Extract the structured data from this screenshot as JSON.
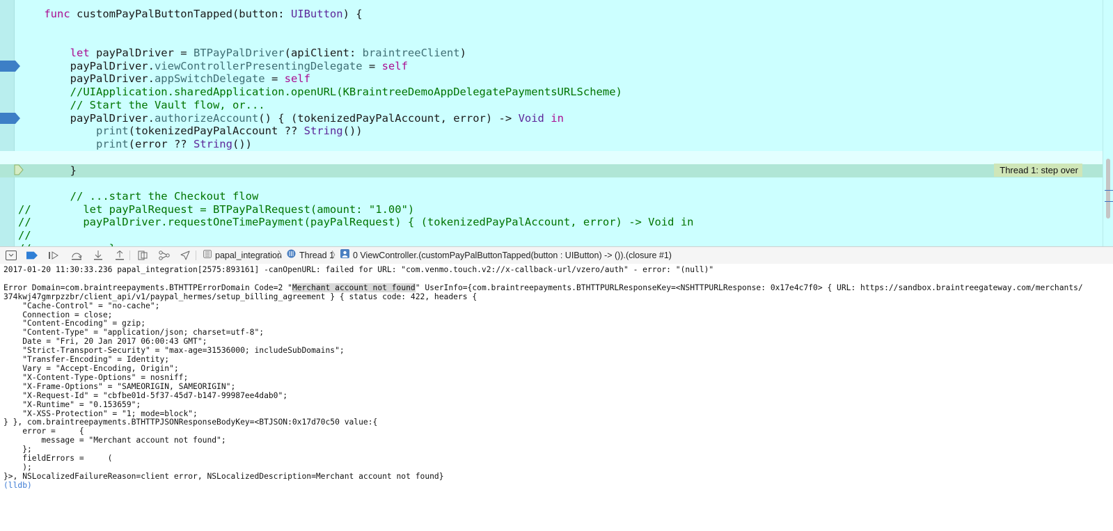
{
  "editor": {
    "lines": [
      {
        "segs": [
          [
            "plain",
            "    "
          ],
          [
            "kw",
            "func"
          ],
          [
            "plain",
            " customPayPalButtonTapped(button: "
          ],
          [
            "ty",
            "UIButton"
          ],
          [
            "plain",
            ") {"
          ]
        ]
      },
      {
        "segs": []
      },
      {
        "segs": [
          [
            "plain",
            "        "
          ],
          [
            "kw",
            "let"
          ],
          [
            "plain",
            " payPalDriver = "
          ],
          [
            "cls",
            "BTPayPalDriver"
          ],
          [
            "plain",
            "(apiClient: "
          ],
          [
            "prop",
            "braintreeClient"
          ],
          [
            "plain",
            ")"
          ]
        ]
      },
      {
        "segs": [
          [
            "plain",
            "        payPalDriver."
          ],
          [
            "prop",
            "viewControllerPresentingDelegate"
          ],
          [
            "plain",
            " = "
          ],
          [
            "kw",
            "self"
          ]
        ]
      },
      {
        "segs": [
          [
            "plain",
            "        payPalDriver."
          ],
          [
            "prop",
            "appSwitchDelegate"
          ],
          [
            "plain",
            " = "
          ],
          [
            "kw",
            "self"
          ]
        ]
      },
      {
        "segs": [
          [
            "cm",
            "        //UIApplication.sharedApplication.openURL(KBraintreeDemoAppDelegatePaymentsURLScheme)"
          ]
        ]
      },
      {
        "segs": [
          [
            "cm",
            "        // Start the Vault flow, or..."
          ]
        ]
      },
      {
        "segs": [
          [
            "plain",
            "        payPalDriver."
          ],
          [
            "prop",
            "authorizeAccount"
          ],
          [
            "plain",
            "() { (tokenizedPayPalAccount, error) -> "
          ],
          [
            "ty",
            "Void"
          ],
          [
            "plain",
            " "
          ],
          [
            "kw",
            "in"
          ]
        ]
      },
      {
        "segs": [
          [
            "plain",
            "            "
          ],
          [
            "prop",
            "print"
          ],
          [
            "plain",
            "(tokenizedPayPalAccount ?? "
          ],
          [
            "ty",
            "String"
          ],
          [
            "plain",
            "())"
          ]
        ]
      },
      {
        "segs": [
          [
            "plain",
            "            "
          ],
          [
            "prop",
            "print"
          ],
          [
            "plain",
            "(error ?? "
          ],
          [
            "ty",
            "String"
          ],
          [
            "plain",
            "())"
          ]
        ]
      },
      {
        "segs": []
      },
      {
        "segs": []
      },
      {
        "segs": [
          [
            "plain",
            "        }"
          ]
        ]
      },
      {
        "segs": []
      },
      {
        "segs": [
          [
            "cm",
            "        // ...start the Checkout flow"
          ]
        ]
      },
      {
        "segs": [
          [
            "cm",
            "//        let payPalRequest = BTPayPalRequest(amount: \"1.00\")"
          ]
        ]
      },
      {
        "segs": [
          [
            "cm",
            "//        payPalDriver.requestOneTimePayment(payPalRequest) { (tokenizedPayPalAccount, error) -> Void in"
          ]
        ]
      },
      {
        "segs": [
          [
            "cm",
            "//"
          ]
        ]
      },
      {
        "segs": [
          [
            "cm",
            "//            }"
          ]
        ]
      }
    ],
    "thread_label": "Thread 1: step over"
  },
  "debugbar": {
    "icons": [
      "hide-debug-area-icon",
      "breakpoints-toggle-icon",
      "continue-icon",
      "step-over-icon",
      "step-into-icon",
      "step-out-icon",
      "debug-view-hierarchy-icon",
      "memory-graph-icon",
      "simulate-location-icon"
    ],
    "target": "papal_integration",
    "thread": "Thread 1",
    "frame": "0 ViewController.(customPayPalButtonTapped(button : UIButton) -> ()).(closure #1)"
  },
  "console": {
    "line1": "2017-01-20 11:30:33.236 papal_integration[2575:893161] -canOpenURL: failed for URL: \"com.venmo.touch.v2://x-callback-url/vzero/auth\" - error: \"(null)\"",
    "error_prefix": "Error Domain=com.braintreepayments.BTHTTPErrorDomain Code=2 \"",
    "error_highlight": "Merchant account not found",
    "error_suffix": "\" UserInfo={com.braintreepayments.BTHTTPURLResponseKey=<NSHTTPURLResponse: 0x17e4c7f0> { URL: https://sandbox.braintreegateway.com/merchants/",
    "body": "374kwj47gmrpzzbr/client_api/v1/paypal_hermes/setup_billing_agreement } { status code: 422, headers {\n    \"Cache-Control\" = \"no-cache\";\n    Connection = close;\n    \"Content-Encoding\" = gzip;\n    \"Content-Type\" = \"application/json; charset=utf-8\";\n    Date = \"Fri, 20 Jan 2017 06:00:43 GMT\";\n    \"Strict-Transport-Security\" = \"max-age=31536000; includeSubDomains\";\n    \"Transfer-Encoding\" = Identity;\n    Vary = \"Accept-Encoding, Origin\";\n    \"X-Content-Type-Options\" = nosniff;\n    \"X-Frame-Options\" = \"SAMEORIGIN, SAMEORIGIN\";\n    \"X-Request-Id\" = \"cbfbe01d-5f37-45d7-b147-99987ee4dab0\";\n    \"X-Runtime\" = \"0.153659\";\n    \"X-XSS-Protection\" = \"1; mode=block\";\n} }, com.braintreepayments.BTHTTPJSONResponseBodyKey=<BTJSON:0x17d70c50 value:{\n    error =     {\n        message = \"Merchant account not found\";\n    };\n    fieldErrors =     (\n    );\n}>, NSLocalizedFailureReason=client error, NSLocalizedDescription=Merchant account not found}",
    "prompt": "(lldb)"
  }
}
